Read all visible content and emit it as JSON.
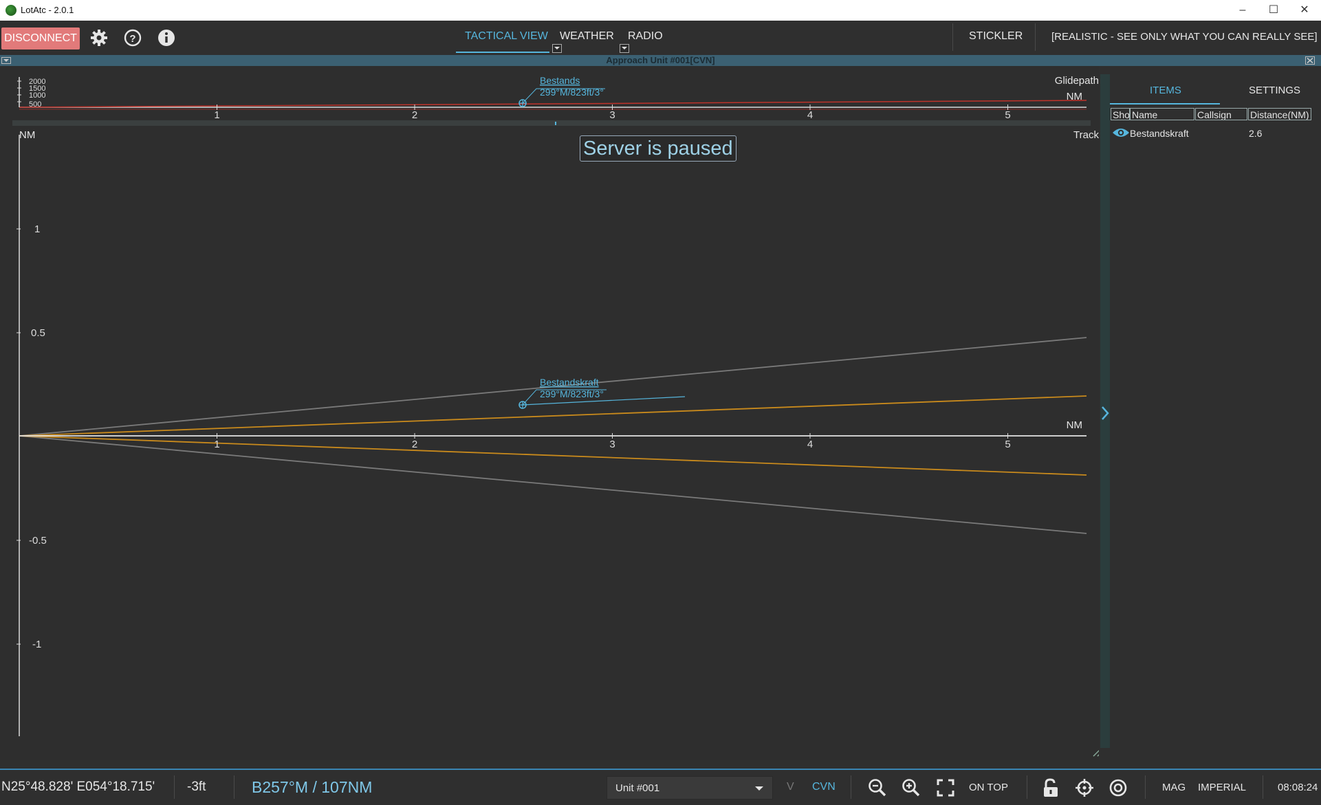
{
  "window": {
    "title": "LotAtc - 2.0.1",
    "controls": {
      "minimize": "–",
      "maximize": "☐",
      "close": "✕"
    }
  },
  "toolbar": {
    "disconnect_label": "DISCONNECT",
    "tabs": [
      {
        "label": "TACTICAL VIEW",
        "active": true
      },
      {
        "label": "WEATHER",
        "active": false
      },
      {
        "label": "RADIO",
        "active": false
      }
    ],
    "stickler_label": "STICKLER",
    "mode_label": "[REALISTIC - SEE ONLY WHAT YOU CAN REALLY SEE]",
    "icons": [
      "gear-icon",
      "help-icon",
      "info-icon"
    ]
  },
  "approach_bar": {
    "title": "Approach Unit #001[CVN]"
  },
  "overlay": {
    "paused_text": "Server is paused"
  },
  "glidepath": {
    "title": "Glidepath",
    "axis_unit": "NM",
    "x_ticks": [
      "1",
      "2",
      "3",
      "4",
      "5"
    ],
    "y_ticks": [
      "2000",
      "1500",
      "1000",
      "500"
    ],
    "label_name": "Bestands",
    "label_info": "299°M/823ft/3°"
  },
  "track": {
    "title": "Track",
    "x_unit": "NM",
    "y_unit": "NM",
    "x_ticks": [
      "1",
      "2",
      "3",
      "4",
      "5"
    ],
    "y_ticks": [
      "1",
      "0.5",
      "-0.5",
      "-1"
    ],
    "label_name": "Bestandskraft",
    "label_info": "299°M/823ft/3°"
  },
  "side_panel": {
    "tabs": [
      {
        "label": "ITEMS",
        "active": true
      },
      {
        "label": "SETTINGS",
        "active": false
      }
    ],
    "columns": [
      "Sho",
      "Name",
      "Callsign",
      "Distance(NM)"
    ],
    "rows": [
      {
        "name": "Bestandskraft",
        "callsign": "",
        "distance": "2.6"
      }
    ]
  },
  "statusbar": {
    "coords": "N25°48.828' E054°18.715'",
    "altitude": "-3ft",
    "bearing": "B257°M / 107NM",
    "unit_selected": "Unit #001",
    "v_label": "V",
    "cvn_label": "CVN",
    "on_top_label": "ON TOP",
    "mag_label": "MAG",
    "imperial_label": "IMPERIAL",
    "time": "08:08:24"
  },
  "colors": {
    "accent": "#56b6dd",
    "disconnect": "#e27a7a",
    "approach_line": "#c98a1c",
    "glidepath_line": "#c0332b",
    "cone_line": "#7a7a7a"
  }
}
